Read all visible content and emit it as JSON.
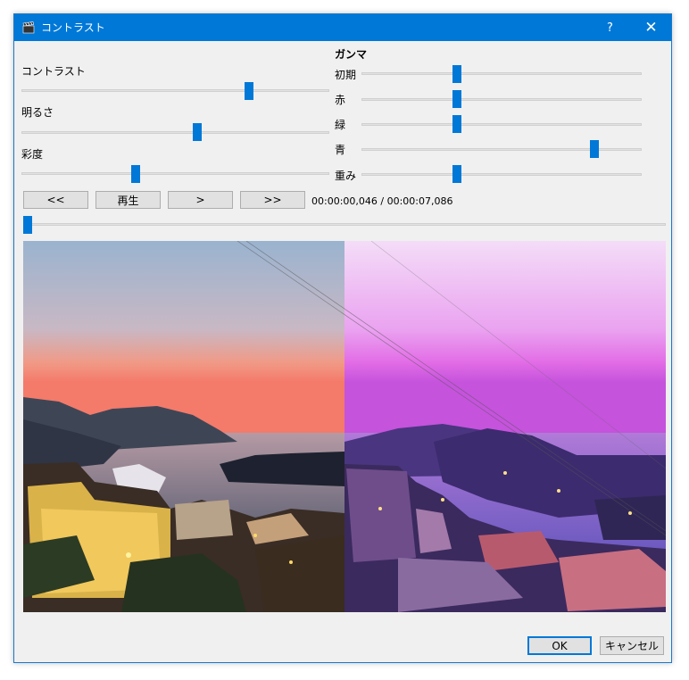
{
  "window": {
    "title": "コントラスト",
    "help_label": "?",
    "close_label": "✕"
  },
  "left_sliders": [
    {
      "label": "コントラスト",
      "value": 0.74
    },
    {
      "label": "明るさ",
      "value": 0.57
    },
    {
      "label": "彩度",
      "value": 0.37
    }
  ],
  "gamma": {
    "heading": "ガンマ",
    "sliders": [
      {
        "label": "初期",
        "value": 0.34
      },
      {
        "label": "赤",
        "value": 0.34
      },
      {
        "label": "緑",
        "value": 0.34
      },
      {
        "label": "青",
        "value": 0.83
      },
      {
        "label": "重み",
        "value": 0.34
      }
    ]
  },
  "playback": {
    "rewind_label": "<<",
    "play_label": "再生",
    "step_label": ">",
    "forward_label": ">>",
    "time_text": "00:00:00,046 / 00:00:07,086",
    "seek_value": 0.0
  },
  "footer": {
    "ok_label": "OK",
    "cancel_label": "キャンセル"
  },
  "colors": {
    "accent": "#0078d7",
    "titlebar": "#0078d7"
  },
  "icons": {
    "app": "clapperboard-icon",
    "help": "question-icon",
    "close": "close-icon"
  }
}
